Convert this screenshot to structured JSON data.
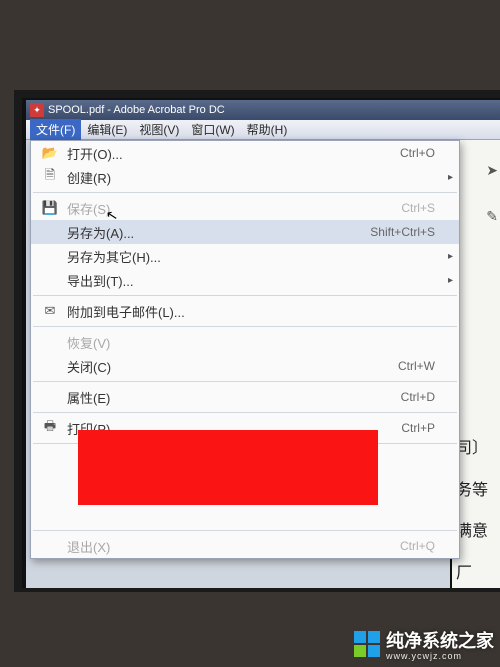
{
  "titleBar": {
    "text": "SPOOL.pdf - Adobe Acrobat Pro DC"
  },
  "menuBar": {
    "items": [
      {
        "label": "文件(F)",
        "active": true
      },
      {
        "label": "编辑(E)"
      },
      {
        "label": "视图(V)"
      },
      {
        "label": "窗口(W)"
      },
      {
        "label": "帮助(H)"
      }
    ]
  },
  "fileMenu": {
    "items": [
      {
        "label": "打开(O)...",
        "shortcut": "Ctrl+O",
        "icon": "folder-open-icon",
        "disabled": false,
        "submenu": false
      },
      {
        "label": "创建(R)",
        "shortcut": "",
        "icon": "create-icon",
        "disabled": false,
        "submenu": true
      },
      {
        "sep": true
      },
      {
        "label": "保存(S)",
        "shortcut": "Ctrl+S",
        "icon": "save-icon",
        "disabled": true,
        "submenu": false
      },
      {
        "label": "另存为(A)...",
        "shortcut": "Shift+Ctrl+S",
        "icon": "",
        "disabled": false,
        "submenu": false,
        "hover": true
      },
      {
        "label": "另存为其它(H)...",
        "shortcut": "",
        "icon": "",
        "disabled": false,
        "submenu": true
      },
      {
        "label": "导出到(T)...",
        "shortcut": "",
        "icon": "",
        "disabled": false,
        "submenu": true
      },
      {
        "sep": true
      },
      {
        "label": "附加到电子邮件(L)...",
        "shortcut": "",
        "icon": "mail-icon",
        "disabled": false,
        "submenu": false
      },
      {
        "sep": true
      },
      {
        "label": "恢复(V)",
        "shortcut": "",
        "icon": "",
        "disabled": true,
        "submenu": false
      },
      {
        "label": "关闭(C)",
        "shortcut": "Ctrl+W",
        "icon": "",
        "disabled": false,
        "submenu": false
      },
      {
        "sep": true
      },
      {
        "label": "属性(E)",
        "shortcut": "Ctrl+D",
        "icon": "",
        "disabled": false,
        "submenu": false
      },
      {
        "sep": true
      },
      {
        "label": "打印(P)",
        "shortcut": "Ctrl+P",
        "icon": "print-icon",
        "disabled": false,
        "submenu": false
      },
      {
        "sep": true
      },
      {
        "spacer": true
      },
      {
        "sep": true
      },
      {
        "label": "退出(X)",
        "shortcut": "Ctrl+Q",
        "icon": "",
        "disabled": true,
        "submenu": false
      }
    ]
  },
  "docText": [
    "司〕",
    "务等",
    "满意厂"
  ],
  "watermark": {
    "brand": "纯净系统之家",
    "url": "www.ycwjz.com"
  }
}
